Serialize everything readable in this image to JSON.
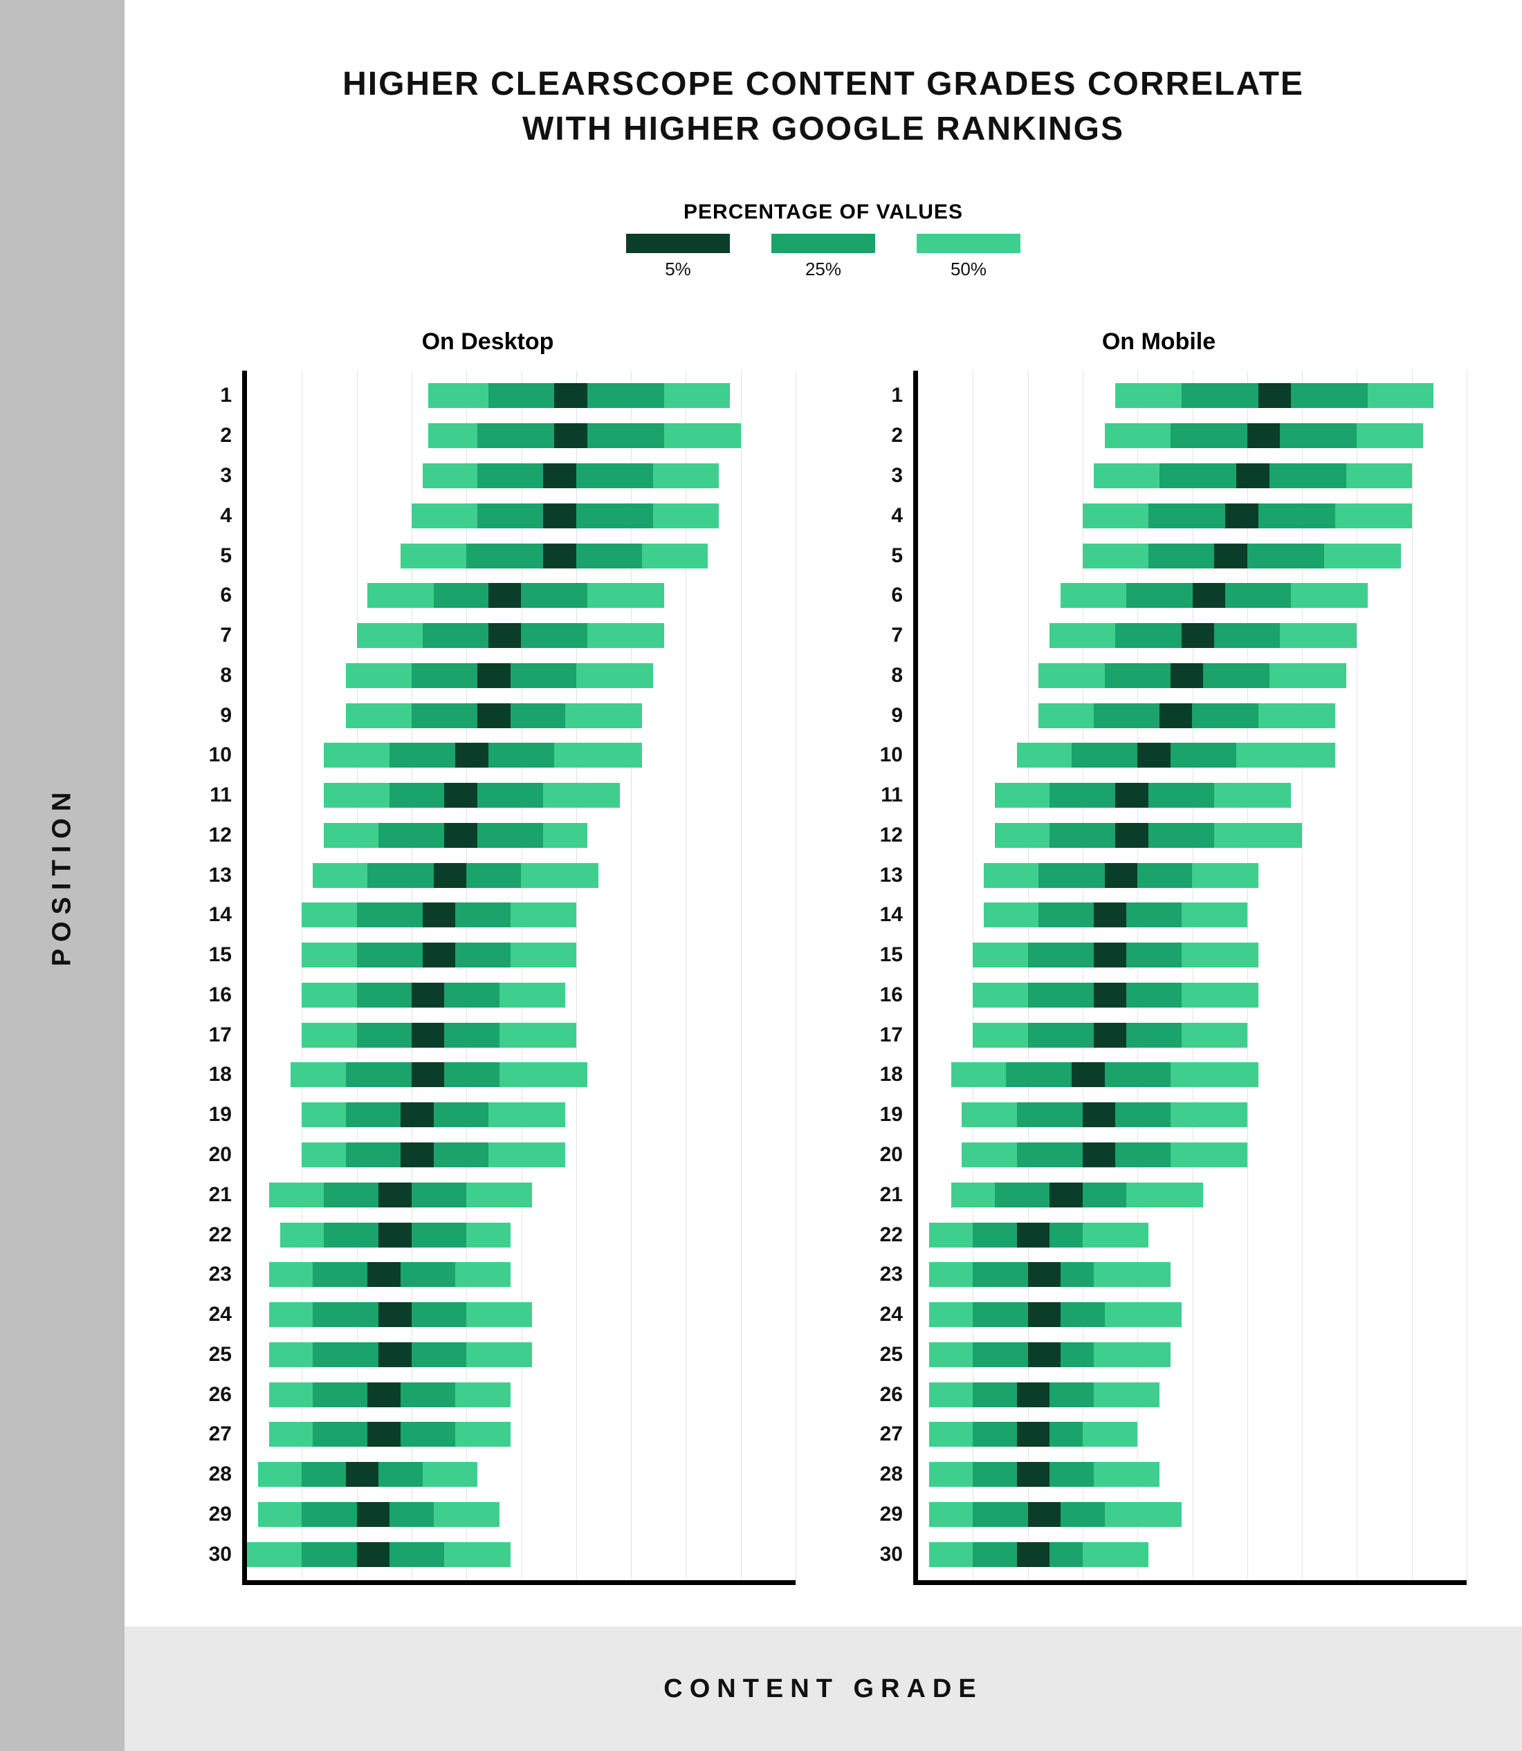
{
  "title_line1": "HIGHER CLEARSCOPE CONTENT GRADES CORRELATE",
  "title_line2": "WITH HIGHER GOOGLE RANKINGS",
  "legend": {
    "title": "PERCENTAGE OF VALUES",
    "items": [
      {
        "label": "5%",
        "color": "#0b3e2a"
      },
      {
        "label": "25%",
        "color": "#1aa36a"
      },
      {
        "label": "50%",
        "color": "#3ecf8e"
      }
    ]
  },
  "ylabel": "POSITION",
  "xlabel": "CONTENT GRADE",
  "axis": {
    "min": 0,
    "max": 100,
    "gridlines": [
      10,
      20,
      30,
      40,
      50,
      60,
      70,
      80,
      90,
      100
    ]
  },
  "chart_data": [
    {
      "title": "On Desktop",
      "type": "range-bar",
      "positions": [
        {
          "pos": 1,
          "p50_lo": 33,
          "p50_hi": 88,
          "p25_lo": 44,
          "p25_hi": 76,
          "p5_lo": 56,
          "p5_hi": 62
        },
        {
          "pos": 2,
          "p50_lo": 33,
          "p50_hi": 90,
          "p25_lo": 42,
          "p25_hi": 76,
          "p5_lo": 56,
          "p5_hi": 62
        },
        {
          "pos": 3,
          "p50_lo": 32,
          "p50_hi": 86,
          "p25_lo": 42,
          "p25_hi": 74,
          "p5_lo": 54,
          "p5_hi": 60
        },
        {
          "pos": 4,
          "p50_lo": 30,
          "p50_hi": 86,
          "p25_lo": 42,
          "p25_hi": 74,
          "p5_lo": 54,
          "p5_hi": 60
        },
        {
          "pos": 5,
          "p50_lo": 28,
          "p50_hi": 84,
          "p25_lo": 40,
          "p25_hi": 72,
          "p5_lo": 54,
          "p5_hi": 60
        },
        {
          "pos": 6,
          "p50_lo": 22,
          "p50_hi": 76,
          "p25_lo": 34,
          "p25_hi": 62,
          "p5_lo": 44,
          "p5_hi": 50
        },
        {
          "pos": 7,
          "p50_lo": 20,
          "p50_hi": 76,
          "p25_lo": 32,
          "p25_hi": 62,
          "p5_lo": 44,
          "p5_hi": 50
        },
        {
          "pos": 8,
          "p50_lo": 18,
          "p50_hi": 74,
          "p25_lo": 30,
          "p25_hi": 60,
          "p5_lo": 42,
          "p5_hi": 48
        },
        {
          "pos": 9,
          "p50_lo": 18,
          "p50_hi": 72,
          "p25_lo": 30,
          "p25_hi": 58,
          "p5_lo": 42,
          "p5_hi": 48
        },
        {
          "pos": 10,
          "p50_lo": 14,
          "p50_hi": 72,
          "p25_lo": 26,
          "p25_hi": 56,
          "p5_lo": 38,
          "p5_hi": 44
        },
        {
          "pos": 11,
          "p50_lo": 14,
          "p50_hi": 68,
          "p25_lo": 26,
          "p25_hi": 54,
          "p5_lo": 36,
          "p5_hi": 42
        },
        {
          "pos": 12,
          "p50_lo": 14,
          "p50_hi": 62,
          "p25_lo": 24,
          "p25_hi": 54,
          "p5_lo": 36,
          "p5_hi": 42
        },
        {
          "pos": 13,
          "p50_lo": 12,
          "p50_hi": 64,
          "p25_lo": 22,
          "p25_hi": 50,
          "p5_lo": 34,
          "p5_hi": 40
        },
        {
          "pos": 14,
          "p50_lo": 10,
          "p50_hi": 60,
          "p25_lo": 20,
          "p25_hi": 48,
          "p5_lo": 32,
          "p5_hi": 38
        },
        {
          "pos": 15,
          "p50_lo": 10,
          "p50_hi": 60,
          "p25_lo": 20,
          "p25_hi": 48,
          "p5_lo": 32,
          "p5_hi": 38
        },
        {
          "pos": 16,
          "p50_lo": 10,
          "p50_hi": 58,
          "p25_lo": 20,
          "p25_hi": 46,
          "p5_lo": 30,
          "p5_hi": 36
        },
        {
          "pos": 17,
          "p50_lo": 10,
          "p50_hi": 60,
          "p25_lo": 20,
          "p25_hi": 46,
          "p5_lo": 30,
          "p5_hi": 36
        },
        {
          "pos": 18,
          "p50_lo": 8,
          "p50_hi": 62,
          "p25_lo": 18,
          "p25_hi": 46,
          "p5_lo": 30,
          "p5_hi": 36
        },
        {
          "pos": 19,
          "p50_lo": 10,
          "p50_hi": 58,
          "p25_lo": 18,
          "p25_hi": 44,
          "p5_lo": 28,
          "p5_hi": 34
        },
        {
          "pos": 20,
          "p50_lo": 10,
          "p50_hi": 58,
          "p25_lo": 18,
          "p25_hi": 44,
          "p5_lo": 28,
          "p5_hi": 34
        },
        {
          "pos": 21,
          "p50_lo": 4,
          "p50_hi": 52,
          "p25_lo": 14,
          "p25_hi": 40,
          "p5_lo": 24,
          "p5_hi": 30
        },
        {
          "pos": 22,
          "p50_lo": 6,
          "p50_hi": 48,
          "p25_lo": 14,
          "p25_hi": 40,
          "p5_lo": 24,
          "p5_hi": 30
        },
        {
          "pos": 23,
          "p50_lo": 4,
          "p50_hi": 48,
          "p25_lo": 12,
          "p25_hi": 38,
          "p5_lo": 22,
          "p5_hi": 28
        },
        {
          "pos": 24,
          "p50_lo": 4,
          "p50_hi": 52,
          "p25_lo": 12,
          "p25_hi": 40,
          "p5_lo": 24,
          "p5_hi": 30
        },
        {
          "pos": 25,
          "p50_lo": 4,
          "p50_hi": 52,
          "p25_lo": 12,
          "p25_hi": 40,
          "p5_lo": 24,
          "p5_hi": 30
        },
        {
          "pos": 26,
          "p50_lo": 4,
          "p50_hi": 48,
          "p25_lo": 12,
          "p25_hi": 38,
          "p5_lo": 22,
          "p5_hi": 28
        },
        {
          "pos": 27,
          "p50_lo": 4,
          "p50_hi": 48,
          "p25_lo": 12,
          "p25_hi": 38,
          "p5_lo": 22,
          "p5_hi": 28
        },
        {
          "pos": 28,
          "p50_lo": 2,
          "p50_hi": 42,
          "p25_lo": 10,
          "p25_hi": 32,
          "p5_lo": 18,
          "p5_hi": 24
        },
        {
          "pos": 29,
          "p50_lo": 2,
          "p50_hi": 46,
          "p25_lo": 10,
          "p25_hi": 34,
          "p5_lo": 20,
          "p5_hi": 26
        },
        {
          "pos": 30,
          "p50_lo": 0,
          "p50_hi": 48,
          "p25_lo": 10,
          "p25_hi": 36,
          "p5_lo": 20,
          "p5_hi": 26
        }
      ]
    },
    {
      "title": "On Mobile",
      "type": "range-bar",
      "positions": [
        {
          "pos": 1,
          "p50_lo": 36,
          "p50_hi": 94,
          "p25_lo": 48,
          "p25_hi": 82,
          "p5_lo": 62,
          "p5_hi": 68
        },
        {
          "pos": 2,
          "p50_lo": 34,
          "p50_hi": 92,
          "p25_lo": 46,
          "p25_hi": 80,
          "p5_lo": 60,
          "p5_hi": 66
        },
        {
          "pos": 3,
          "p50_lo": 32,
          "p50_hi": 90,
          "p25_lo": 44,
          "p25_hi": 78,
          "p5_lo": 58,
          "p5_hi": 64
        },
        {
          "pos": 4,
          "p50_lo": 30,
          "p50_hi": 90,
          "p25_lo": 42,
          "p25_hi": 76,
          "p5_lo": 56,
          "p5_hi": 62
        },
        {
          "pos": 5,
          "p50_lo": 30,
          "p50_hi": 88,
          "p25_lo": 42,
          "p25_hi": 74,
          "p5_lo": 54,
          "p5_hi": 60
        },
        {
          "pos": 6,
          "p50_lo": 26,
          "p50_hi": 82,
          "p25_lo": 38,
          "p25_hi": 68,
          "p5_lo": 50,
          "p5_hi": 56
        },
        {
          "pos": 7,
          "p50_lo": 24,
          "p50_hi": 80,
          "p25_lo": 36,
          "p25_hi": 66,
          "p5_lo": 48,
          "p5_hi": 54
        },
        {
          "pos": 8,
          "p50_lo": 22,
          "p50_hi": 78,
          "p25_lo": 34,
          "p25_hi": 64,
          "p5_lo": 46,
          "p5_hi": 52
        },
        {
          "pos": 9,
          "p50_lo": 22,
          "p50_hi": 76,
          "p25_lo": 32,
          "p25_hi": 62,
          "p5_lo": 44,
          "p5_hi": 50
        },
        {
          "pos": 10,
          "p50_lo": 18,
          "p50_hi": 76,
          "p25_lo": 28,
          "p25_hi": 58,
          "p5_lo": 40,
          "p5_hi": 46
        },
        {
          "pos": 11,
          "p50_lo": 14,
          "p50_hi": 68,
          "p25_lo": 24,
          "p25_hi": 54,
          "p5_lo": 36,
          "p5_hi": 42
        },
        {
          "pos": 12,
          "p50_lo": 14,
          "p50_hi": 70,
          "p25_lo": 24,
          "p25_hi": 54,
          "p5_lo": 36,
          "p5_hi": 42
        },
        {
          "pos": 13,
          "p50_lo": 12,
          "p50_hi": 62,
          "p25_lo": 22,
          "p25_hi": 50,
          "p5_lo": 34,
          "p5_hi": 40
        },
        {
          "pos": 14,
          "p50_lo": 12,
          "p50_hi": 60,
          "p25_lo": 22,
          "p25_hi": 48,
          "p5_lo": 32,
          "p5_hi": 38
        },
        {
          "pos": 15,
          "p50_lo": 10,
          "p50_hi": 62,
          "p25_lo": 20,
          "p25_hi": 48,
          "p5_lo": 32,
          "p5_hi": 38
        },
        {
          "pos": 16,
          "p50_lo": 10,
          "p50_hi": 62,
          "p25_lo": 20,
          "p25_hi": 48,
          "p5_lo": 32,
          "p5_hi": 38
        },
        {
          "pos": 17,
          "p50_lo": 10,
          "p50_hi": 60,
          "p25_lo": 20,
          "p25_hi": 48,
          "p5_lo": 32,
          "p5_hi": 38
        },
        {
          "pos": 18,
          "p50_lo": 6,
          "p50_hi": 62,
          "p25_lo": 16,
          "p25_hi": 46,
          "p5_lo": 28,
          "p5_hi": 34
        },
        {
          "pos": 19,
          "p50_lo": 8,
          "p50_hi": 60,
          "p25_lo": 18,
          "p25_hi": 46,
          "p5_lo": 30,
          "p5_hi": 36
        },
        {
          "pos": 20,
          "p50_lo": 8,
          "p50_hi": 60,
          "p25_lo": 18,
          "p25_hi": 46,
          "p5_lo": 30,
          "p5_hi": 36
        },
        {
          "pos": 21,
          "p50_lo": 6,
          "p50_hi": 52,
          "p25_lo": 14,
          "p25_hi": 38,
          "p5_lo": 24,
          "p5_hi": 30
        },
        {
          "pos": 22,
          "p50_lo": 2,
          "p50_hi": 42,
          "p25_lo": 10,
          "p25_hi": 30,
          "p5_lo": 18,
          "p5_hi": 24
        },
        {
          "pos": 23,
          "p50_lo": 2,
          "p50_hi": 46,
          "p25_lo": 10,
          "p25_hi": 32,
          "p5_lo": 20,
          "p5_hi": 26
        },
        {
          "pos": 24,
          "p50_lo": 2,
          "p50_hi": 48,
          "p25_lo": 10,
          "p25_hi": 34,
          "p5_lo": 20,
          "p5_hi": 26
        },
        {
          "pos": 25,
          "p50_lo": 2,
          "p50_hi": 46,
          "p25_lo": 10,
          "p25_hi": 32,
          "p5_lo": 20,
          "p5_hi": 26
        },
        {
          "pos": 26,
          "p50_lo": 2,
          "p50_hi": 44,
          "p25_lo": 10,
          "p25_hi": 32,
          "p5_lo": 18,
          "p5_hi": 24
        },
        {
          "pos": 27,
          "p50_lo": 2,
          "p50_hi": 40,
          "p25_lo": 10,
          "p25_hi": 30,
          "p5_lo": 18,
          "p5_hi": 24
        },
        {
          "pos": 28,
          "p50_lo": 2,
          "p50_hi": 44,
          "p25_lo": 10,
          "p25_hi": 32,
          "p5_lo": 18,
          "p5_hi": 24
        },
        {
          "pos": 29,
          "p50_lo": 2,
          "p50_hi": 48,
          "p25_lo": 10,
          "p25_hi": 34,
          "p5_lo": 20,
          "p5_hi": 26
        },
        {
          "pos": 30,
          "p50_lo": 2,
          "p50_hi": 42,
          "p25_lo": 10,
          "p25_hi": 30,
          "p5_lo": 18,
          "p5_hi": 24
        }
      ]
    }
  ]
}
